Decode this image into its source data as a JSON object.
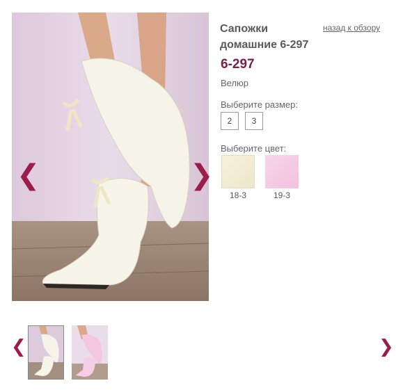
{
  "product": {
    "title": "Сапожки домашние 6-297",
    "sku": "6-297",
    "material": "Велюр"
  },
  "nav": {
    "back_label": "назад к обзору",
    "prev_icon": "chevron-left-icon",
    "next_icon": "chevron-right-icon",
    "prev_glyph": "❮",
    "next_glyph": "❯"
  },
  "sizes": {
    "label": "Выберите размер:",
    "options": [
      "2",
      "3"
    ]
  },
  "colors": {
    "label": "Выберите цвет:",
    "options": [
      {
        "code": "18-3",
        "color": "#f4efd8"
      },
      {
        "code": "19-3",
        "color": "#f5cde4"
      }
    ]
  },
  "theme": {
    "accent": "#9c1d4a",
    "sku_color": "#7b1f44"
  }
}
